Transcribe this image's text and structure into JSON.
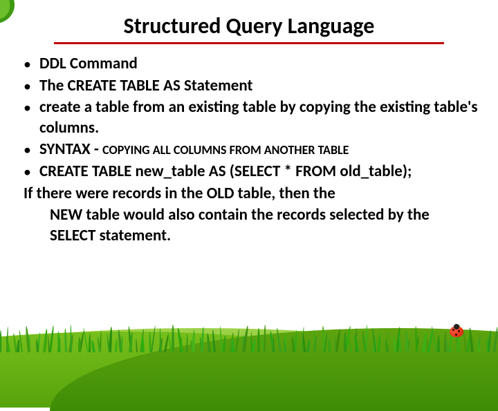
{
  "title": "Structured Query Language",
  "bullets": {
    "b1": "DDL  Command",
    "b2": "The CREATE TABLE AS Statement",
    "b3": "create a table from an existing table by copying the existing table's columns.",
    "b4_prefix": "SYNTAX - ",
    "b4_sub": "COPYING ALL COLUMNS FROM ANOTHER TABLE",
    "b5": "CREATE TABLE new_table AS (SELECT * FROM old_table);"
  },
  "footer_line1": "If there were records in the OLD table, then the",
  "footer_line2": "NEW table would also contain the records selected by the SELECT statement."
}
